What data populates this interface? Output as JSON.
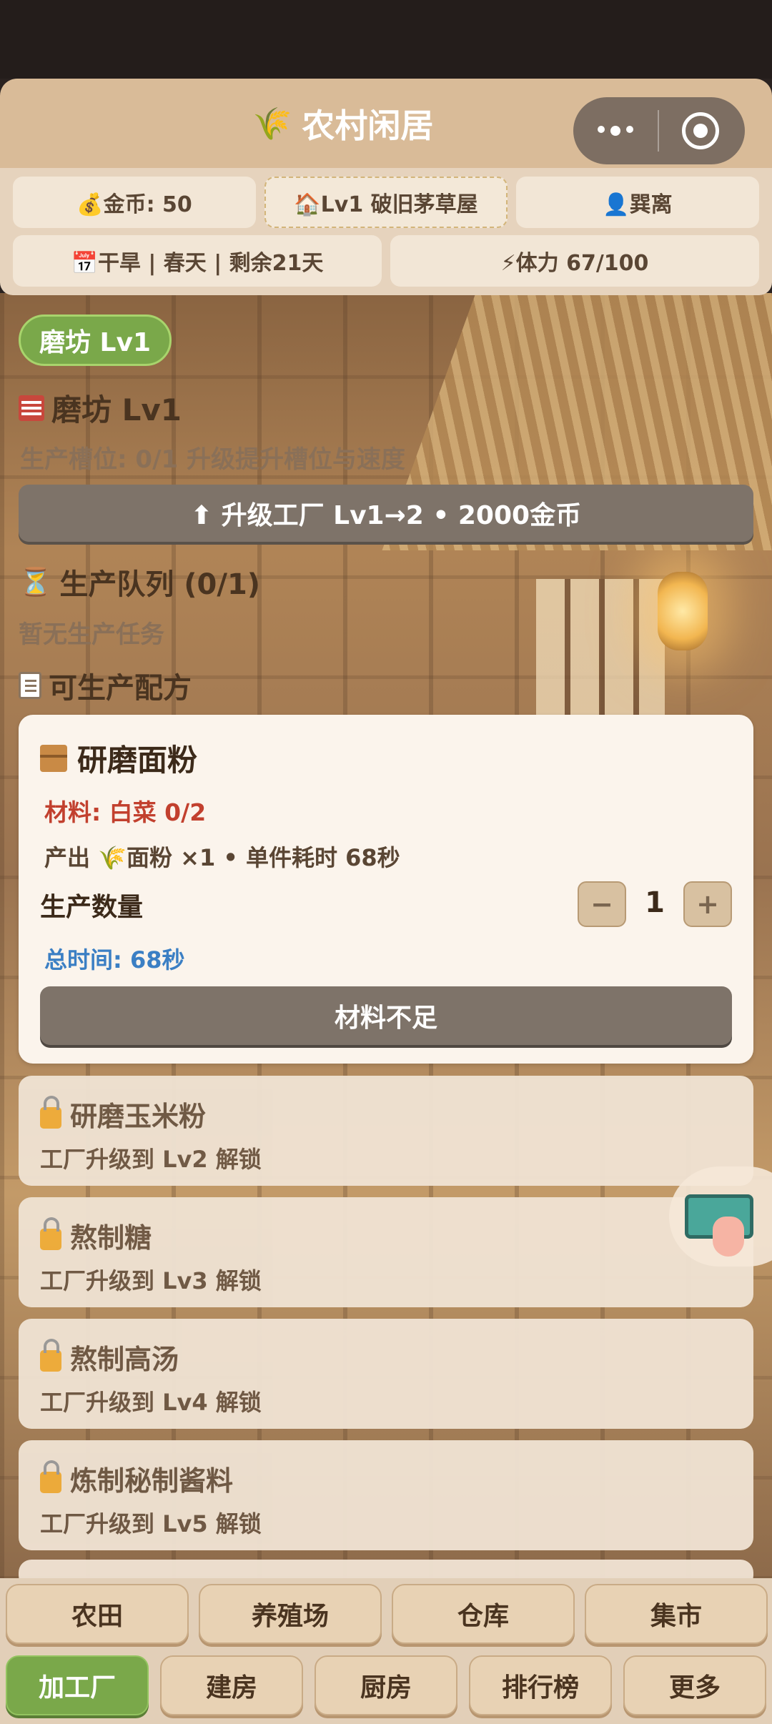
{
  "header": {
    "title": "农村闲居"
  },
  "stats": {
    "gold": "💰金币: 50",
    "house": "🏠Lv1 破旧茅草屋",
    "player": "👤巽离",
    "date": "📅干旱 | 春天 | 剩余21天",
    "stamina": "⚡体力 67/100"
  },
  "factory": {
    "badge": "磨坊 Lv1",
    "title": "磨坊  Lv1",
    "slot_info": "生产槽位: 0/1  升级提升槽位与速度",
    "upgrade_label": "⬆ 升级工厂  Lv1→2  •  2000金币"
  },
  "queue": {
    "title": "生产队列 (0/1)",
    "empty_text": "暂无生产任务"
  },
  "recipes_title": "可生产配方",
  "recipe": {
    "name": "研磨面粉",
    "material": "材料: 白菜 0/2",
    "output": "产出 🌾面粉 ×1  •  单件耗时 68秒",
    "qty_label": "生产数量",
    "minus": "−",
    "qty": "1",
    "plus": "+",
    "total_time": "总时间: 68秒",
    "button": "材料不足"
  },
  "locked": [
    {
      "name": "研磨玉米粉",
      "req": "工厂升级到 Lv2 解锁"
    },
    {
      "name": "熬制糖",
      "req": "工厂升级到 Lv3 解锁"
    },
    {
      "name": "熬制高汤",
      "req": "工厂升级到 Lv4 解锁"
    },
    {
      "name": "炼制秘制酱料",
      "req": "工厂升级到 Lv5 解锁"
    }
  ],
  "nav_row1": [
    "农田",
    "养殖场",
    "仓库",
    "集市"
  ],
  "nav_row2": [
    "加工厂",
    "建房",
    "厨房",
    "排行榜",
    "更多"
  ],
  "colors": {
    "accent_green": "#7aa84a",
    "header_bg": "#d9bb98",
    "danger_red": "#c2402e",
    "info_blue": "#3b7fc4"
  }
}
